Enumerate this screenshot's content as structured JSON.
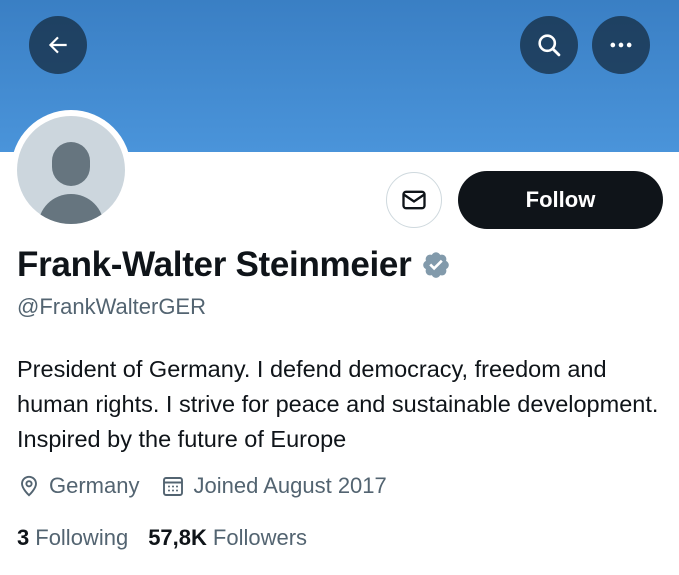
{
  "header": {
    "back_icon": "arrow-left-icon",
    "search_icon": "search-icon",
    "more_icon": "more-horizontal-icon",
    "banner_color": "#4a94da"
  },
  "profile": {
    "name": "Frank-Walter Steinmeier",
    "handle": "@FrankWalterGER",
    "verified_icon": "verified-badge-icon",
    "verified_color": "#829aab",
    "bio": "President of Germany. I defend democracy, freedom and human rights. I strive for peace and sustainable development. Inspired by the future of Europe",
    "location": "Germany",
    "location_icon": "location-pin-icon",
    "joined": "Joined August 2017",
    "joined_icon": "calendar-icon"
  },
  "actions": {
    "message_icon": "envelope-icon",
    "follow_label": "Follow"
  },
  "stats": {
    "following_count": "3",
    "following_label": "Following",
    "followers_count": "57,8K",
    "followers_label": "Followers"
  }
}
